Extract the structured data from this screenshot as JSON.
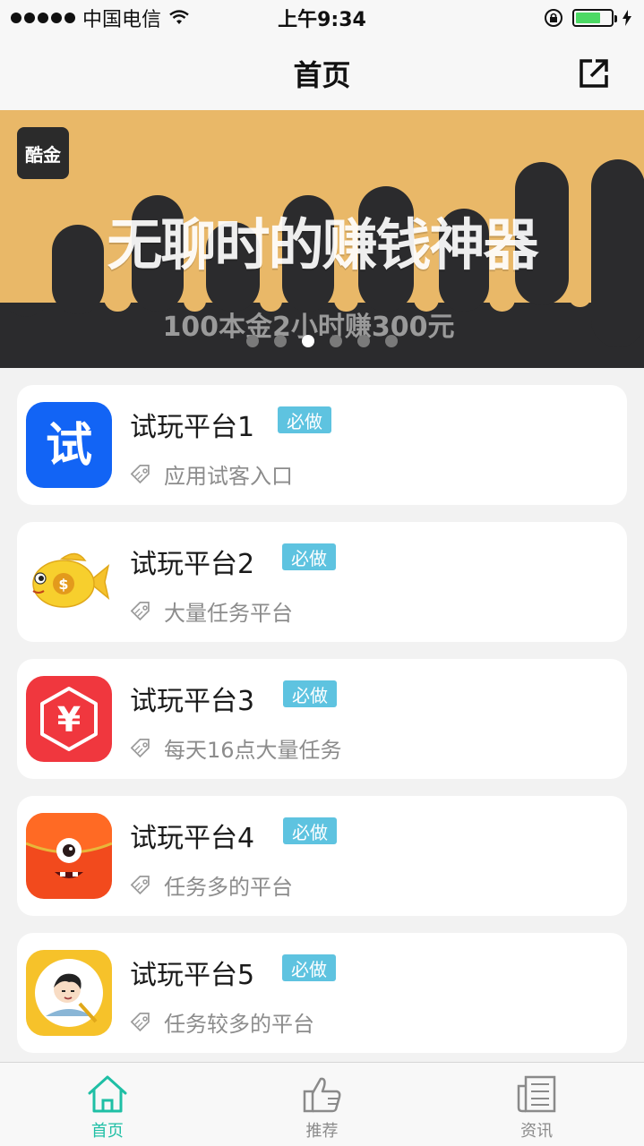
{
  "status_bar": {
    "carrier": "中国电信",
    "time": "上午9:34"
  },
  "nav": {
    "title": "首页"
  },
  "banner": {
    "logo_text": "酷金",
    "headline": "无聊时的赚钱神器",
    "subline": "100本金2小时赚300元",
    "page_count": 6,
    "active_index": 2
  },
  "apps": [
    {
      "title": "试玩平台1",
      "badge": "必做",
      "desc": "应用试客入口",
      "icon": "shi-blue-icon"
    },
    {
      "title": "试玩平台2",
      "badge": "必做",
      "desc": "大量任务平台",
      "icon": "gold-fish-icon"
    },
    {
      "title": "试玩平台3",
      "badge": "必做",
      "desc": "每天16点大量任务",
      "icon": "yuan-hexagon-icon"
    },
    {
      "title": "试玩平台4",
      "badge": "必做",
      "desc": "任务多的平台",
      "icon": "red-envelope-monster-icon"
    },
    {
      "title": "试玩平台5",
      "badge": "必做",
      "desc": "任务较多的平台",
      "icon": "cartoon-boy-icon"
    }
  ],
  "tabs": [
    {
      "label": "首页",
      "icon": "home-icon",
      "active": true
    },
    {
      "label": "推荐",
      "icon": "thumbs-up-icon",
      "active": false
    },
    {
      "label": "资讯",
      "icon": "news-icon",
      "active": false
    }
  ],
  "colors": {
    "accent": "#1fbfa5",
    "badge": "#5ec3e0",
    "banner_gold": "#e9b868",
    "banner_dark": "#2b2b2d"
  }
}
